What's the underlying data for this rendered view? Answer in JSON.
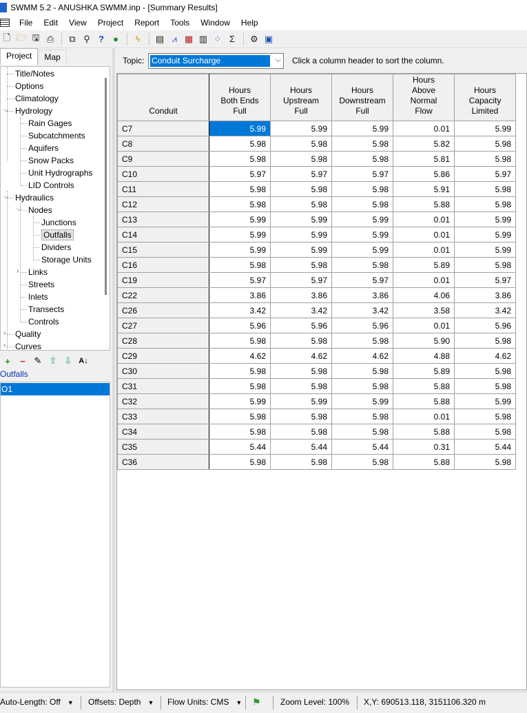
{
  "window": {
    "title": "SWMM 5.2 - ANUSHKA SWMM.inp - [Summary Results]"
  },
  "menu": [
    "File",
    "Edit",
    "View",
    "Project",
    "Report",
    "Tools",
    "Window",
    "Help"
  ],
  "toolbar_icons": [
    "new-file-icon",
    "open-folder-icon",
    "save-icon",
    "print-icon",
    "copy-icon",
    "find-icon",
    "whats-this-icon",
    "globe-icon",
    "run-lightning-icon",
    "status-report-icon",
    "profile-plot-icon",
    "time-series-plot-icon",
    "table-icon",
    "scatter-plot-icon",
    "sigma-icon",
    "options-icon",
    "tile-windows-icon"
  ],
  "left_panel": {
    "tabs": [
      "Project",
      "Map"
    ],
    "tree": [
      {
        "label": "Title/Notes",
        "level": 1
      },
      {
        "label": "Options",
        "level": 1
      },
      {
        "label": "Climatology",
        "level": 1
      },
      {
        "label": "Hydrology",
        "level": 1,
        "expander": "expanded"
      },
      {
        "label": "Rain Gages",
        "level": 2
      },
      {
        "label": "Subcatchments",
        "level": 2
      },
      {
        "label": "Aquifers",
        "level": 2
      },
      {
        "label": "Snow Packs",
        "level": 2
      },
      {
        "label": "Unit Hydrographs",
        "level": 2
      },
      {
        "label": "LID Controls",
        "level": 2
      },
      {
        "label": "Hydraulics",
        "level": 1,
        "expander": "expanded"
      },
      {
        "label": "Nodes",
        "level": 2,
        "expander": "expanded"
      },
      {
        "label": "Junctions",
        "level": 3
      },
      {
        "label": "Outfalls",
        "level": 3,
        "selected": true
      },
      {
        "label": "Dividers",
        "level": 3
      },
      {
        "label": "Storage Units",
        "level": 3
      },
      {
        "label": "Links",
        "level": 2,
        "expander": "collapsed"
      },
      {
        "label": "Streets",
        "level": 2
      },
      {
        "label": "Inlets",
        "level": 2
      },
      {
        "label": "Transects",
        "level": 2
      },
      {
        "label": "Controls",
        "level": 2
      },
      {
        "label": "Quality",
        "level": 1,
        "expander": "collapsed"
      },
      {
        "label": "Curves",
        "level": 1,
        "expander": "collapsed"
      }
    ],
    "object_tools": [
      "add-icon",
      "delete-icon",
      "edit-icon",
      "move-up-icon",
      "move-down-icon",
      "sort-az-icon"
    ],
    "object_type_label": "Outfalls",
    "objects": [
      "O1"
    ]
  },
  "topic": {
    "label": "Topic:",
    "selected": "Conduit Surcharge",
    "hint": "Click a column header to sort the column."
  },
  "table": {
    "columns": [
      "Conduit",
      "Hours\nBoth Ends\nFull",
      "Hours\nUpstream\nFull",
      "Hours\nDownstream\nFull",
      "Hours\nAbove\nNormal\nFlow",
      "Hours\nCapacity\nLimited"
    ],
    "rows": [
      [
        "C7",
        "5.99",
        "5.99",
        "5.99",
        "0.01",
        "5.99"
      ],
      [
        "C8",
        "5.98",
        "5.98",
        "5.98",
        "5.82",
        "5.98"
      ],
      [
        "C9",
        "5.98",
        "5.98",
        "5.98",
        "5.81",
        "5.98"
      ],
      [
        "C10",
        "5.97",
        "5.97",
        "5.97",
        "5.86",
        "5.97"
      ],
      [
        "C11",
        "5.98",
        "5.98",
        "5.98",
        "5.91",
        "5.98"
      ],
      [
        "C12",
        "5.98",
        "5.98",
        "5.98",
        "5.88",
        "5.98"
      ],
      [
        "C13",
        "5.99",
        "5.99",
        "5.99",
        "0.01",
        "5.99"
      ],
      [
        "C14",
        "5.99",
        "5.99",
        "5.99",
        "0.01",
        "5.99"
      ],
      [
        "C15",
        "5.99",
        "5.99",
        "5.99",
        "0.01",
        "5.99"
      ],
      [
        "C16",
        "5.98",
        "5.98",
        "5.98",
        "5.89",
        "5.98"
      ],
      [
        "C19",
        "5.97",
        "5.97",
        "5.97",
        "0.01",
        "5.97"
      ],
      [
        "C22",
        "3.86",
        "3.86",
        "3.86",
        "4.06",
        "3.86"
      ],
      [
        "C26",
        "3.42",
        "3.42",
        "3.42",
        "3.58",
        "3.42"
      ],
      [
        "C27",
        "5.96",
        "5.96",
        "5.96",
        "0.01",
        "5.96"
      ],
      [
        "C28",
        "5.98",
        "5.98",
        "5.98",
        "5.90",
        "5.98"
      ],
      [
        "C29",
        "4.62",
        "4.62",
        "4.62",
        "4.88",
        "4.62"
      ],
      [
        "C30",
        "5.98",
        "5.98",
        "5.98",
        "5.89",
        "5.98"
      ],
      [
        "C31",
        "5.98",
        "5.98",
        "5.98",
        "5.88",
        "5.98"
      ],
      [
        "C32",
        "5.99",
        "5.99",
        "5.99",
        "5.88",
        "5.99"
      ],
      [
        "C33",
        "5.98",
        "5.98",
        "5.98",
        "0.01",
        "5.98"
      ],
      [
        "C34",
        "5.98",
        "5.98",
        "5.98",
        "5.88",
        "5.98"
      ],
      [
        "C35",
        "5.44",
        "5.44",
        "5.44",
        "0.31",
        "5.44"
      ],
      [
        "C36",
        "5.98",
        "5.98",
        "5.98",
        "5.88",
        "5.98"
      ]
    ]
  },
  "statusbar": {
    "auto_length": "Auto-Length: Off",
    "offsets": "Offsets: Depth",
    "flow_units": "Flow Units: CMS",
    "zoom": "Zoom Level: 100%",
    "xy": "X,Y: 690513.118, 3151106.320 m"
  },
  "colors": {
    "selection": "#0078d7",
    "window_bg": "#f0f0f0",
    "link_blue": "#0033aa"
  }
}
